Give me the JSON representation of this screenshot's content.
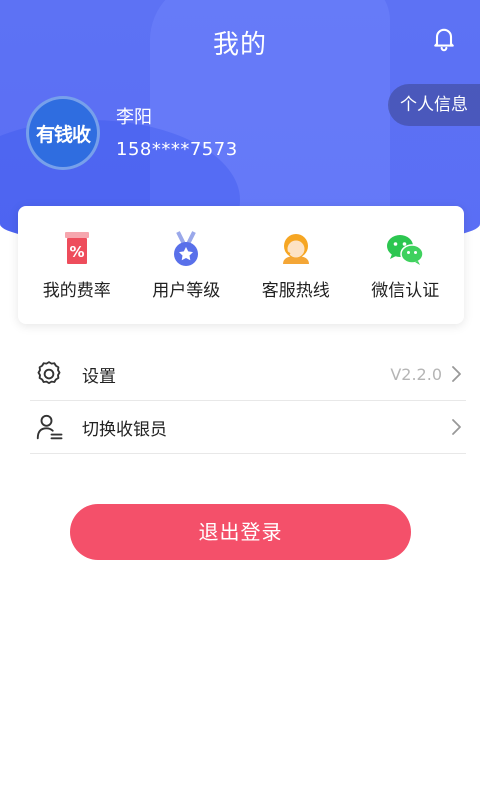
{
  "header": {
    "title": "我的",
    "profile_button": "个人信息",
    "bell_icon": "bell-icon"
  },
  "user": {
    "avatar_text": "有钱收",
    "name": "李阳",
    "phone": "158****7573"
  },
  "quick_actions": [
    {
      "label": "我的费率",
      "icon": "rate-icon"
    },
    {
      "label": "用户等级",
      "icon": "medal-icon"
    },
    {
      "label": "客服热线",
      "icon": "customer-service-icon"
    },
    {
      "label": "微信认证",
      "icon": "wechat-icon"
    }
  ],
  "menu": {
    "settings_label": "设置",
    "settings_value": "V2.2.0",
    "switch_cashier_label": "切换收银员"
  },
  "logout_label": "退出登录",
  "colors": {
    "header_blue": "#5d72f4",
    "logout_red": "#f4506a"
  }
}
